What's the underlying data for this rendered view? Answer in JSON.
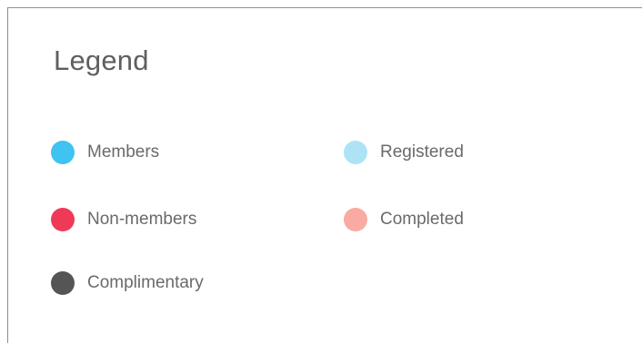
{
  "legend": {
    "title": "Legend",
    "items": [
      {
        "label": "Members",
        "color": "#3fc3f0",
        "icon": "members-dot-icon"
      },
      {
        "label": "Registered",
        "color": "#aee3f6",
        "icon": "registered-dot-icon"
      },
      {
        "label": "Non-members",
        "color": "#ee3a58",
        "icon": "non-members-dot-icon"
      },
      {
        "label": "Completed",
        "color": "#f9aaa2",
        "icon": "completed-dot-icon"
      },
      {
        "label": "Complimentary",
        "color": "#555555",
        "icon": "complimentary-dot-icon"
      }
    ]
  }
}
